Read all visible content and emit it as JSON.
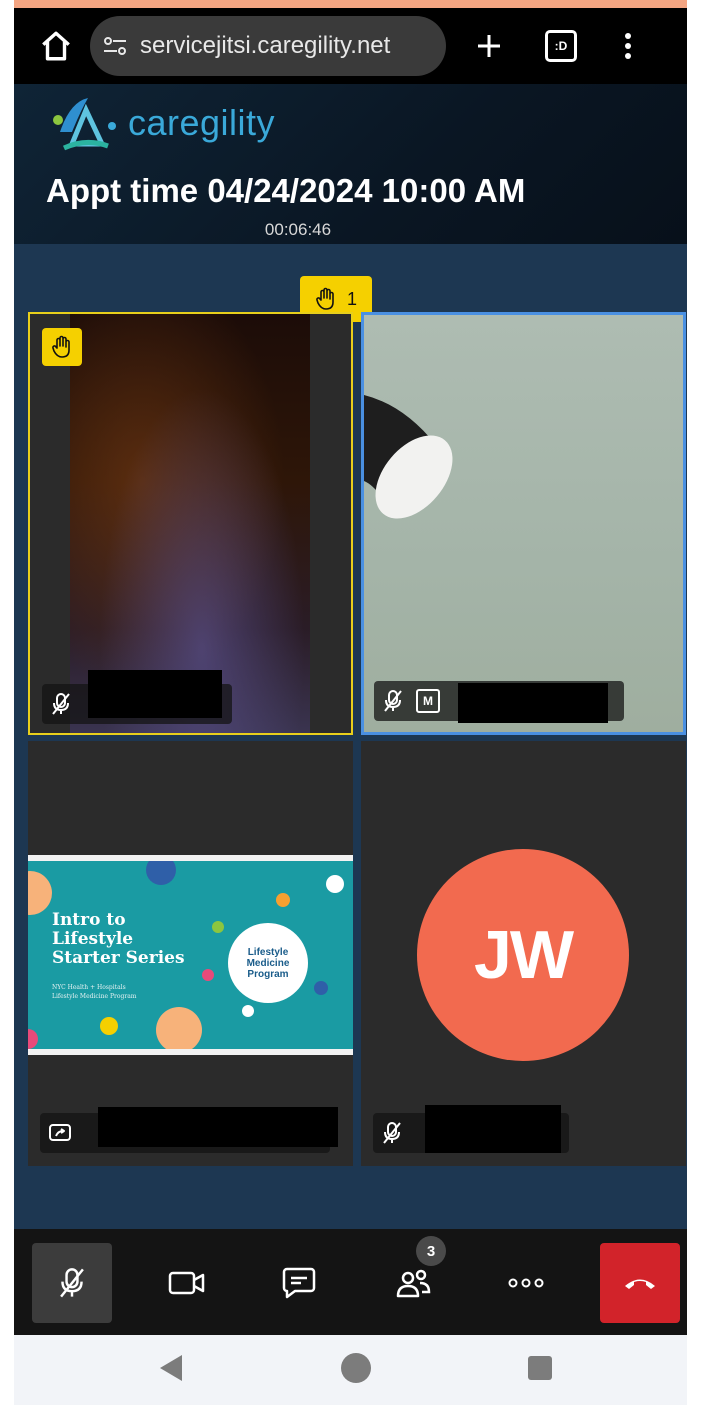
{
  "browser": {
    "url": "servicejitsi.caregility.net",
    "tab_icon_label": ":D"
  },
  "header": {
    "logo_text": "caregility",
    "appt_title": "Appt time 04/24/2024 10:00 AM",
    "timer": "00:06:46"
  },
  "raised_hands": {
    "count": "1"
  },
  "tiles": {
    "moderator_badge": "M",
    "avatar_initials": "JW"
  },
  "slide": {
    "title_lines": [
      "Intro to",
      "Lifestyle",
      "Starter Series"
    ],
    "subtitle_lines": [
      "NYC Health + Hospitals",
      "Lifestyle Medicine Program"
    ],
    "program_lines": [
      "Lifestyle",
      "Medicine",
      "Program"
    ]
  },
  "toolbar": {
    "participants_count": "3",
    "items": [
      "mic-muted-icon",
      "camera-icon",
      "chat-icon",
      "participants-icon",
      "more-icon",
      "hangup-icon"
    ]
  },
  "colors": {
    "raise_hand_yellow": "#f5d000",
    "active_speaker_blue": "#4a90e2",
    "avatar_color": "#f26a4f",
    "hangup_red": "#d2232a",
    "stage_bg": "#1d3752"
  }
}
